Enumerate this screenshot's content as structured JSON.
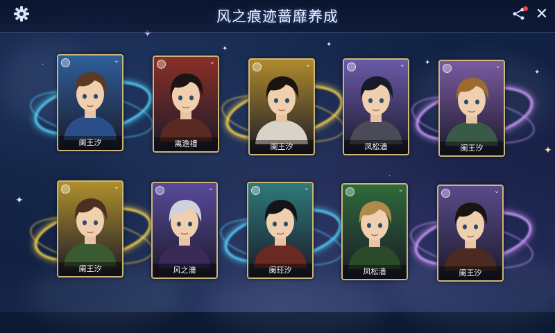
{
  "header": {
    "title": "风之痕迹蔷靡养成",
    "settings_icon": "gear-icon",
    "notify_icon": "share-notification-icon",
    "close_label": "✕"
  },
  "cards": [
    {
      "name": "阑王汐",
      "theme": "#2f5f9a",
      "ring": "#54d6ff",
      "hair": "#5a3a22",
      "outfit": "#2a4f88"
    },
    {
      "name": "离澹禮",
      "theme": "#8a2f27",
      "ring": "",
      "hair": "#1c1412",
      "outfit": "#5a2a22"
    },
    {
      "name": "阑王汐",
      "theme": "#b08a2c",
      "ring": "#ffd84a",
      "hair": "#1a1410",
      "outfit": "#d8d2c8"
    },
    {
      "name": "凤松濇",
      "theme": "#6a5aa8",
      "ring": "",
      "hair": "#161a2a",
      "outfit": "#4a4a58"
    },
    {
      "name": "阑王汐",
      "theme": "#7a5aa0",
      "ring": "#d69cff",
      "hair": "#9a6a30",
      "outfit": "#3a5a48"
    },
    {
      "name": "阑王汐",
      "theme": "#b0902c",
      "ring": "#ffd84a",
      "hair": "#4a3020",
      "outfit": "#3a5a30"
    },
    {
      "name": "风之濇",
      "theme": "#5a4a9a",
      "ring": "",
      "hair": "#cfd2dc",
      "outfit": "#3a2a5a"
    },
    {
      "name": "阑玨汐",
      "theme": "#2f7a7a",
      "ring": "#54d6ff",
      "hair": "#121418",
      "outfit": "#6a2a22"
    },
    {
      "name": "凤松濇",
      "theme": "#2f6a3a",
      "ring": "",
      "hair": "#b08a4a",
      "outfit": "#2a4a2a"
    },
    {
      "name": "阑王汐",
      "theme": "#5a4a8a",
      "ring": "#d69cff",
      "hair": "#1a1410",
      "outfit": "#4a2a22"
    }
  ]
}
